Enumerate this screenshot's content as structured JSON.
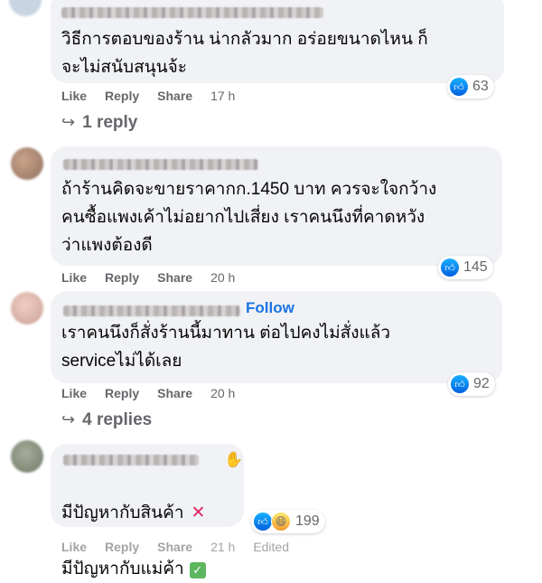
{
  "actions": {
    "like": "Like",
    "reply": "Reply",
    "share": "Share"
  },
  "comments": [
    {
      "text": "วิธีการตอบของร้าน น่ากลัวมาก อร่อยขนาดไหน ก็\nจะไม่สนับสนุนจ้ะ",
      "time": "17 h",
      "reactions": "63",
      "replies": "1 reply"
    },
    {
      "text": "ถ้าร้านคิดจะขายราคากก.1450 บาท ควรจะใจกว้าง\nคนซื้อแพงเค้าไม่อยากไปเสี่ยง เราคนนึงที่คาดหวัง\nว่าแพงต้องดี",
      "time": "20 h",
      "reactions": "145"
    },
    {
      "follow": "Follow",
      "text": "เราคนนึงก็สั่งร้านนี้มาทาน ต่อไปคงไม่สั่งแล้ว\nserviceไม่ได้เลย",
      "time": "20 h",
      "reactions": "92",
      "replies": "4 replies"
    },
    {
      "line1": "มีปัญหากับสินค้า",
      "line2": "มีปัญหากับแม่ค้า",
      "time": "21 h",
      "edited": "Edited",
      "reactions": "199"
    }
  ],
  "icons": {
    "like": "like-icon",
    "haha": "haha-icon",
    "reply_arrow": "reply-arrow-icon",
    "wave": "wave-badge-icon",
    "cross": "cross-mark-icon",
    "check": "check-mark-icon"
  }
}
